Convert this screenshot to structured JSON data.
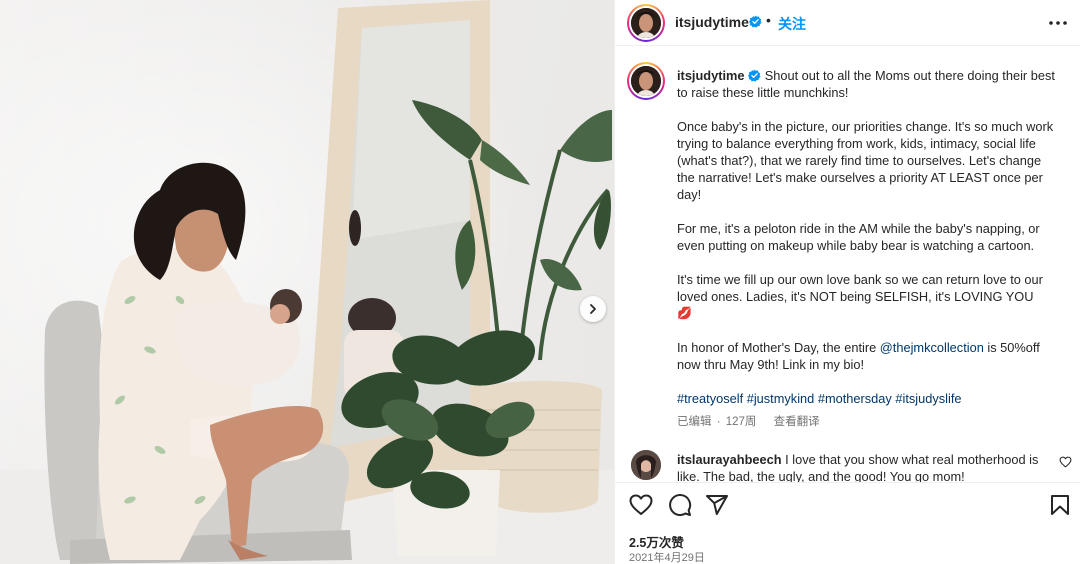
{
  "post": {
    "username": "itsjudytime",
    "follow_label": "关注",
    "caption": {
      "intro": "Shout out to all the Moms out there doing their best to raise these little munchkins!",
      "p2": "Once baby's in the picture, our priorities change. It's so much work trying to balance everything from work, kids, intimacy, social life (what's that?), that we rarely find time to ourselves. Let's change the narrative! Let's make ourselves a priority AT LEAST once per day!",
      "p3": "For me, it's a peloton ride in the AM while the baby's napping, or even putting on makeup while baby bear is watching a cartoon.",
      "p4": "It's time we fill up our own love bank so we can return love to our loved ones. Ladies, it's NOT being SELFISH, it's LOVING YOU",
      "p4_emoji": "💋",
      "p5_before": "In honor of Mother's Day, the entire ",
      "p5_mention": "@thejmkcollection",
      "p5_after": " is 50%off now thru May 9th! Link in my bio!",
      "hashtags": "#treatyoself #justmykind #mothersday #itsjudyslife"
    },
    "meta": {
      "edited": "已编辑",
      "separator": "·",
      "age": "127周",
      "translate": "查看翻译"
    },
    "comment": {
      "username": "itslaurayahbeech",
      "text": "I love that you show what real motherhood is like. The bad, the ugly, and the good! You go mom!"
    },
    "likes": "2.5万次赞",
    "date": "2021年4月29日"
  },
  "icons": {
    "verified": "verified-badge-icon",
    "more": "more-options-icon",
    "like": "heart-icon",
    "comment": "comment-icon",
    "share": "share-icon",
    "save": "bookmark-icon",
    "carousel_next": "chevron-right-icon",
    "comment_like": "small-heart-icon"
  },
  "colors": {
    "verified_blue": "#0095f6",
    "follow_blue": "#0095f6",
    "link": "#00376b",
    "muted": "#737373",
    "text": "#262626"
  }
}
